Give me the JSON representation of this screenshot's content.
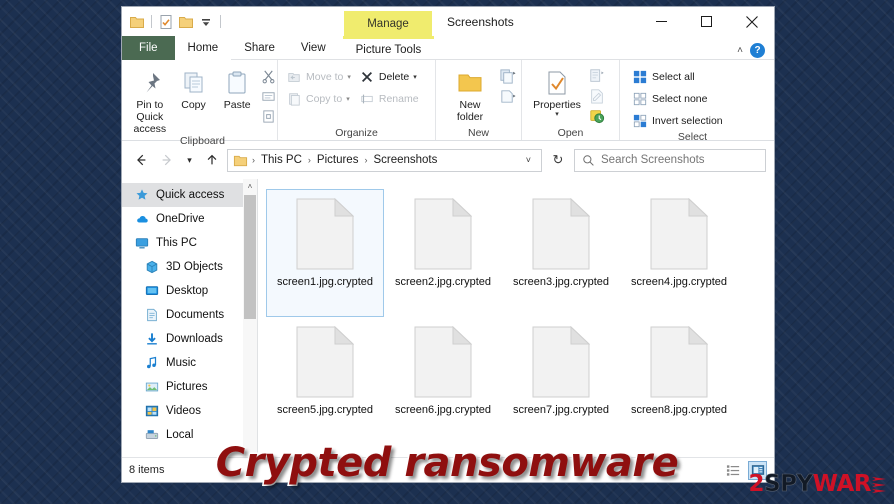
{
  "window": {
    "title": "Screenshots",
    "contextual_tab_group": "Manage",
    "quick_access_icons": [
      "folder-icon",
      "properties-icon",
      "new-folder-icon",
      "customize-qat-caret-icon"
    ],
    "controls": {
      "minimize": "minimize-icon",
      "maximize": "maximize-icon",
      "close": "close-icon"
    }
  },
  "tabs": [
    {
      "label": "File",
      "kind": "file"
    },
    {
      "label": "Home",
      "kind": "active"
    },
    {
      "label": "Share",
      "kind": "normal"
    },
    {
      "label": "View",
      "kind": "normal"
    },
    {
      "label": "Picture Tools",
      "kind": "contextual"
    }
  ],
  "tab_right": {
    "collapse": "˄",
    "help": "?"
  },
  "ribbon": {
    "groups": [
      {
        "label": "Clipboard",
        "big": [
          {
            "label": "Pin to Quick\naccess",
            "icon": "pin-icon"
          },
          {
            "label": "Copy",
            "icon": "copy-icon"
          },
          {
            "label": "Paste",
            "icon": "paste-icon"
          }
        ],
        "stack": [
          {
            "icon": "cut-scissors-icon"
          },
          {
            "icon": "copy-path-icon"
          },
          {
            "icon": "paste-shortcut-icon"
          }
        ]
      },
      {
        "label": "Organize",
        "small": [
          {
            "label": "Move to",
            "icon": "move-to-icon",
            "caret": true,
            "disabled": true
          },
          {
            "label": "Copy to",
            "icon": "copy-to-icon",
            "caret": true,
            "disabled": true
          },
          {
            "label": "Delete",
            "icon": "delete-x-icon",
            "caret": true,
            "disabled": false
          },
          {
            "label": "Rename",
            "icon": "rename-icon",
            "caret": false,
            "disabled": true
          }
        ]
      },
      {
        "label": "New",
        "big": [
          {
            "label": "New\nfolder",
            "icon": "new-folder-icon"
          }
        ],
        "stack": [
          {
            "icon": "new-item-icon"
          },
          {
            "icon": "easy-access-icon"
          }
        ]
      },
      {
        "label": "Open",
        "big": [
          {
            "label": "Properties",
            "icon": "properties-icon",
            "caret": true
          }
        ],
        "stack": [
          {
            "icon": "open-with-icon"
          },
          {
            "icon": "edit-icon"
          },
          {
            "icon": "history-icon"
          }
        ]
      },
      {
        "label": "Select",
        "small": [
          {
            "label": "Select all",
            "icon": "select-all-icon"
          },
          {
            "label": "Select none",
            "icon": "select-none-icon"
          },
          {
            "label": "Invert selection",
            "icon": "invert-selection-icon"
          }
        ]
      }
    ]
  },
  "addressbar": {
    "back": "back-arrow-icon",
    "forward": "forward-arrow-icon",
    "recent": "recent-locations-caret-icon",
    "up": "up-arrow-icon",
    "path_icon": "folder-icon",
    "breadcrumbs": [
      "This PC",
      "Pictures",
      "Screenshots"
    ],
    "separator": "›",
    "dropdown": "˅",
    "refresh": "↻",
    "search_placeholder": "Search Screenshots",
    "search_value": "",
    "search_icon": "search-icon"
  },
  "navpane": {
    "items": [
      {
        "label": "Quick access",
        "icon": "star-icon",
        "selected": true,
        "indent": false
      },
      {
        "label": "OneDrive",
        "icon": "cloud-icon",
        "selected": false,
        "indent": false
      },
      {
        "label": "This PC",
        "icon": "monitor-icon",
        "selected": false,
        "indent": false
      },
      {
        "label": "3D Objects",
        "icon": "3d-objects-icon",
        "selected": false,
        "indent": true
      },
      {
        "label": "Desktop",
        "icon": "desktop-icon",
        "selected": false,
        "indent": true
      },
      {
        "label": "Documents",
        "icon": "documents-icon",
        "selected": false,
        "indent": true
      },
      {
        "label": "Downloads",
        "icon": "downloads-icon",
        "selected": false,
        "indent": true
      },
      {
        "label": "Music",
        "icon": "music-icon",
        "selected": false,
        "indent": true
      },
      {
        "label": "Pictures",
        "icon": "pictures-icon",
        "selected": false,
        "indent": true
      },
      {
        "label": "Videos",
        "icon": "videos-icon",
        "selected": false,
        "indent": true
      },
      {
        "label": "Local ",
        "icon": "local-disk-icon",
        "selected": false,
        "indent": true
      }
    ],
    "scroll_up": "˄"
  },
  "files": [
    {
      "name": "screen1.jpg.crypted",
      "selected": true
    },
    {
      "name": "screen2.jpg.crypted",
      "selected": false
    },
    {
      "name": "screen3.jpg.crypted",
      "selected": false
    },
    {
      "name": "screen4.jpg.crypted",
      "selected": false
    },
    {
      "name": "screen5.jpg.crypted",
      "selected": false
    },
    {
      "name": "screen6.jpg.crypted",
      "selected": false
    },
    {
      "name": "screen7.jpg.crypted",
      "selected": false
    },
    {
      "name": "screen8.jpg.crypted",
      "selected": false
    }
  ],
  "statusbar": {
    "item_count": "8 items",
    "views": [
      {
        "icon": "details-view-icon",
        "active": false
      },
      {
        "icon": "large-icons-view-icon",
        "active": true
      }
    ]
  },
  "overlay": {
    "banner_text": "Crypted ransomware",
    "banner_color": "#8f0f0f",
    "logo": {
      "part1": "2",
      "part2": "SPY",
      "part3": "WAR",
      "part4": "E",
      "accent": "#cf1126",
      "dark": "#121a26"
    }
  },
  "background": {
    "color": "#1c3050",
    "pattern": "greek-key"
  }
}
